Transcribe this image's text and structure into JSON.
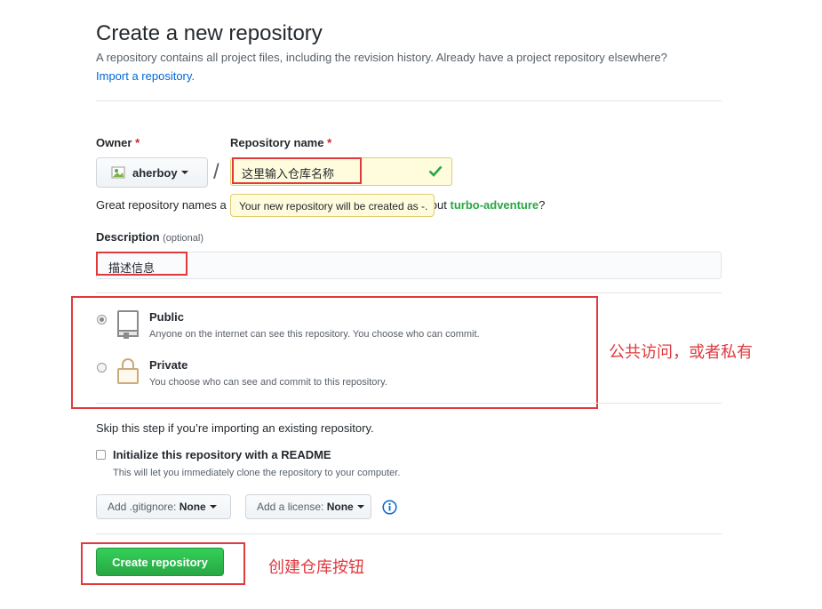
{
  "header": {
    "title": "Create a new repository",
    "description": "A repository contains all project files, including the revision history. Already have a project repository elsewhere?",
    "import_link": "Import a repository."
  },
  "owner": {
    "label": "Owner",
    "required_mark": "*",
    "value": "aherboy"
  },
  "separator": "/",
  "repo_name": {
    "label": "Repository name",
    "required_mark": "*",
    "value": "这里输入仓库名称",
    "tooltip": "Your new repository will be created as -."
  },
  "suggestion": {
    "prefix": "Great repository names a",
    "suffix": "ation? How about ",
    "suggested_name": "turbo-adventure",
    "end": "?"
  },
  "description_field": {
    "label": "Description",
    "optional": "(optional)",
    "value": "描述信息"
  },
  "visibility": {
    "public": {
      "title": "Public",
      "desc": "Anyone on the internet can see this repository. You choose who can commit.",
      "selected": true
    },
    "private": {
      "title": "Private",
      "desc": "You choose who can see and commit to this repository.",
      "selected": false
    }
  },
  "skip_text": "Skip this step if you’re importing an existing repository.",
  "readme": {
    "label": "Initialize this repository with a README",
    "desc": "This will let you immediately clone the repository to your computer.",
    "checked": false
  },
  "gitignore": {
    "prefix": "Add .gitignore:",
    "value": "None"
  },
  "license": {
    "prefix": "Add a license:",
    "value": "None"
  },
  "create_button": "Create repository",
  "annotations": {
    "visibility": "公共访问，或者私有",
    "create": "创建仓库按钮"
  },
  "colors": {
    "accent_green": "#2ea44f",
    "annotation_red": "#e0393e",
    "link_blue": "#0366d6"
  }
}
